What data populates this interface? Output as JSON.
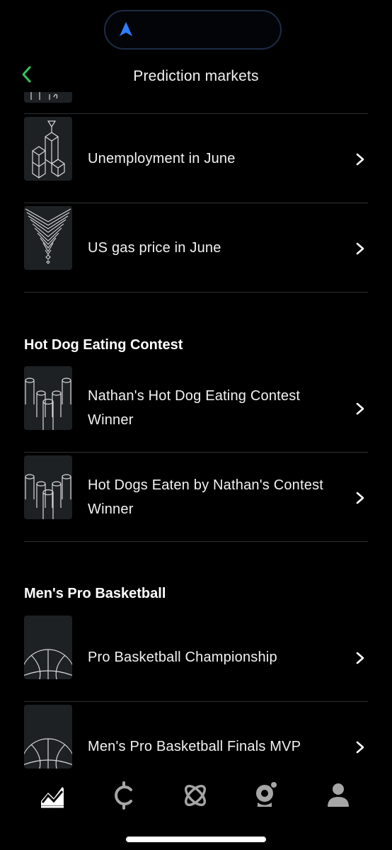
{
  "header": {
    "title": "Prediction markets"
  },
  "sections": [
    {
      "title": "",
      "items": [
        {
          "label": "Unemployment in June",
          "icon": "blocks-icon"
        },
        {
          "label": "US gas price in June",
          "icon": "funnel-icon"
        }
      ]
    },
    {
      "title": "Hot Dog Eating Contest",
      "items": [
        {
          "label": "Nathan's Hot Dog Eating Contest Winner",
          "icon": "cylinders-icon"
        },
        {
          "label": "Hot Dogs Eaten by Nathan's Contest Winner",
          "icon": "cylinders-icon"
        }
      ]
    },
    {
      "title": "Men's Pro Basketball",
      "items": [
        {
          "label": "Pro Basketball Championship",
          "icon": "basketball-icon"
        },
        {
          "label": "Men's Pro Basketball Finals MVP",
          "icon": "basketball-icon"
        }
      ]
    }
  ],
  "tabs": [
    {
      "icon": "markets-chart-icon",
      "active": true
    },
    {
      "icon": "crypto-coin-icon",
      "active": false
    },
    {
      "icon": "orbit-icon",
      "active": false
    },
    {
      "icon": "webcam-icon",
      "active": false
    },
    {
      "icon": "profile-icon",
      "active": false
    }
  ],
  "colors": {
    "background": "#000000",
    "accent_green": "#34c759",
    "island_arrow": "#2f7dff",
    "divider": "#2e3033"
  }
}
